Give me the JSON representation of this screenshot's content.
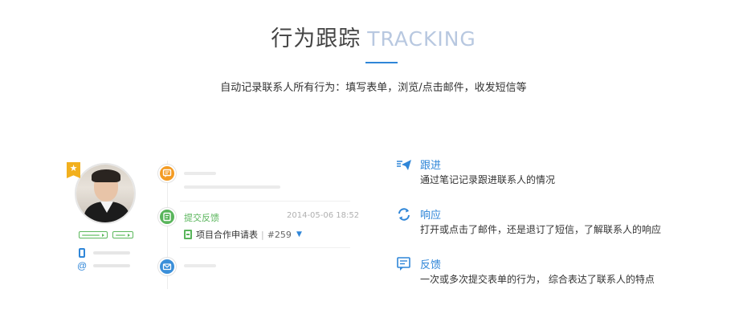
{
  "header": {
    "title_cn": "行为跟踪",
    "title_en": "TRACKING",
    "subtitle": "自动记录联系人所有行为：填写表单，浏览/点击邮件，收发短信等"
  },
  "timeline": {
    "feedback_label": "提交反馈",
    "feedback_time": "2014-05-06 18:52",
    "feedback_item": "项目合作申请表",
    "feedback_separator": "|",
    "feedback_number": "#259"
  },
  "features": [
    {
      "title": "跟进",
      "desc": "通过笔记记录跟进联系人的情况",
      "icon": "send-icon"
    },
    {
      "title": "响应",
      "desc": "打开或点击了邮件，还是退订了短信，了解联系人的响应",
      "icon": "refresh-icon"
    },
    {
      "title": "反馈",
      "desc": "一次或多次提交表单的行为， 综合表达了联系人的特点",
      "icon": "feedback-icon"
    }
  ],
  "colors": {
    "accent": "#2f86d8",
    "title_en": "#b8c8e0",
    "orange": "#f39b23",
    "green": "#59b55b",
    "blue": "#3b8fd9",
    "star": "#f2b01e"
  }
}
